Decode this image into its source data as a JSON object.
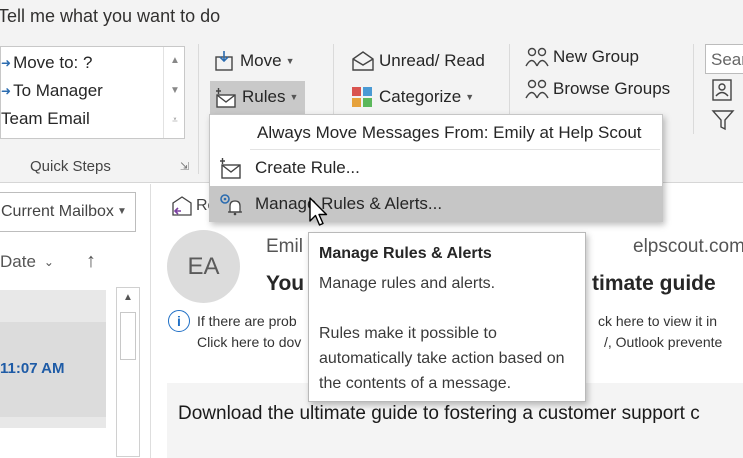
{
  "ribbon": {
    "tell_me": "Tell me what you want to do",
    "quick_steps": {
      "label": "Quick Steps",
      "items": [
        "Move to: ?",
        "To Manager",
        "Team Email"
      ]
    },
    "move": {
      "move_label": "Move",
      "rules_label": "Rules"
    },
    "tags": {
      "unread_label": "Unread/ Read",
      "categorize_label": "Categorize"
    },
    "groups": {
      "new_group_label": "New Group",
      "browse_groups_label": "Browse Groups"
    },
    "search_placeholder": "Sear"
  },
  "rules_menu": {
    "items": [
      "Always Move Messages From: Emily at Help Scout",
      "Create Rule...",
      "Manage Rules & Alerts..."
    ]
  },
  "tooltip": {
    "title": "Manage Rules & Alerts",
    "line1": "Manage rules and alerts.",
    "line2": "Rules make it possible to automatically take action based on the contents of a message."
  },
  "mail_list": {
    "scope": "Current Mailbox",
    "sort_label": "Date",
    "selected_time": "11:07 AM"
  },
  "reading": {
    "reply_label": "Re",
    "avatar_initials": "EA",
    "sender_partial": "Emil",
    "sender_email_partial": "elpscout.com>",
    "subject_left": "You",
    "subject_right": "timate guide",
    "info_line1_left": "If there are prob",
    "info_line1_right": "ck here to view it in",
    "info_line2_left": "Click here to dov",
    "info_line2_right": "/, Outlook prevente",
    "body_text": "Download the ultimate guide to fostering a customer support c"
  },
  "colors": {
    "ribbon_bg": "#f3f3f3",
    "highlight": "#c6c6c6",
    "time_blue": "#1e5ba6",
    "info_blue": "#1f6fc5",
    "icon_blue": "#2b6cb0"
  }
}
